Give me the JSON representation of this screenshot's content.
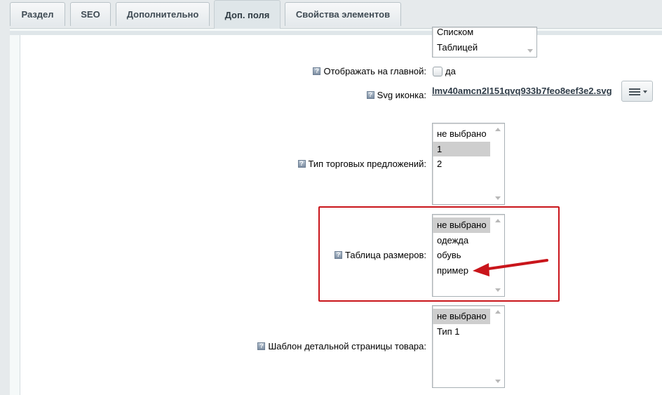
{
  "tabs": [
    {
      "label": "Раздел",
      "active": false
    },
    {
      "label": "SEO",
      "active": false
    },
    {
      "label": "Дополнительно",
      "active": false
    },
    {
      "label": "Доп. поля",
      "active": true
    },
    {
      "label": "Свойства элементов",
      "active": false
    }
  ],
  "help_icon_glyph": "?",
  "top_list": {
    "options": [
      "Списком",
      "Таблицей"
    ]
  },
  "show_on_main": {
    "label": "Отображать на главной:",
    "checkbox_label": "да",
    "checked": false
  },
  "svg_icon": {
    "label": "Svg иконка:",
    "file_name": "lmv40amcn2l151qvq933b7feo8eef3e2.svg"
  },
  "offer_type": {
    "label": "Тип торговых предложений:",
    "options": [
      "не выбрано",
      "1",
      "2"
    ],
    "selected": "1"
  },
  "size_table": {
    "label": "Таблица размеров:",
    "options": [
      "не выбрано",
      "одежда",
      "обувь",
      "пример"
    ],
    "selected": "не выбрано"
  },
  "detail_template": {
    "label": "Шаблон детальной страницы товара:",
    "options": [
      "не выбрано",
      "Тип 1"
    ],
    "selected": "не выбрано"
  },
  "colors": {
    "highlight": "#c9151b",
    "selected_option": "#cecece",
    "tab_active": "#dfe6e9"
  }
}
